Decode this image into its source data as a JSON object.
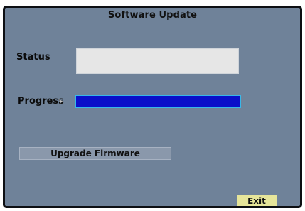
{
  "title": "Software Update",
  "status": {
    "label": "Status",
    "value": ""
  },
  "progress": {
    "label": "Progress",
    "value_fraction": 1.0
  },
  "buttons": {
    "upgrade_label": "Upgrade Firmware",
    "exit_label": "Exit"
  },
  "colors": {
    "panel_bg": "#6f8299",
    "status_box": "#e6e6e6",
    "progress_fill": "#0a0fc9",
    "exit_button": "#e6e59a"
  },
  "icons": {
    "cursor": "mouse-cursor-icon"
  }
}
